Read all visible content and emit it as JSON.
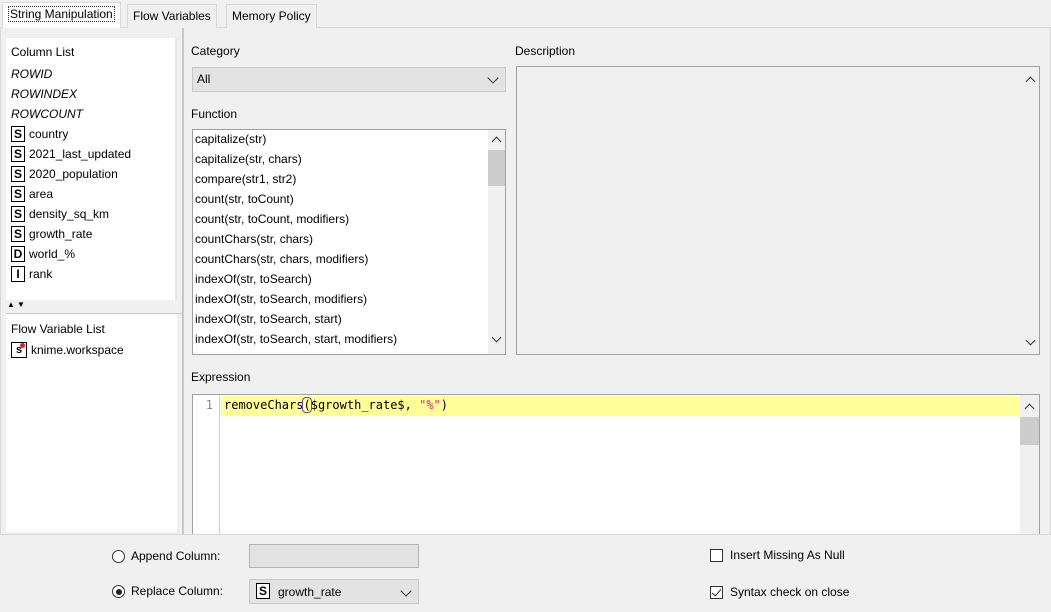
{
  "tabs": [
    {
      "label": "String Manipulation",
      "active": true
    },
    {
      "label": "Flow Variables",
      "active": false
    },
    {
      "label": "Memory Policy",
      "active": false
    }
  ],
  "column_list": {
    "title": "Column List",
    "special": [
      "ROWID",
      "ROWINDEX",
      "ROWCOUNT"
    ],
    "columns": [
      {
        "type": "S",
        "name": "country"
      },
      {
        "type": "S",
        "name": "2021_last_updated"
      },
      {
        "type": "S",
        "name": "2020_population"
      },
      {
        "type": "S",
        "name": "area"
      },
      {
        "type": "S",
        "name": "density_sq_km"
      },
      {
        "type": "S",
        "name": "growth_rate"
      },
      {
        "type": "D",
        "name": "world_%"
      },
      {
        "type": "I",
        "name": "rank"
      }
    ]
  },
  "flow_variable_list": {
    "title": "Flow Variable List",
    "items": [
      {
        "type": "s",
        "name": "knime.workspace"
      }
    ]
  },
  "category": {
    "label": "Category",
    "selected": "All"
  },
  "function": {
    "label": "Function",
    "items": [
      "capitalize(str)",
      "capitalize(str, chars)",
      "compare(str1, str2)",
      "count(str, toCount)",
      "count(str, toCount, modifiers)",
      "countChars(str, chars)",
      "countChars(str, chars, modifiers)",
      "indexOf(str, toSearch)",
      "indexOf(str, toSearch, modifiers)",
      "indexOf(str, toSearch, start)",
      "indexOf(str, toSearch, start, modifiers)"
    ]
  },
  "description": {
    "label": "Description"
  },
  "expression": {
    "label": "Expression",
    "line_number": "1",
    "code_fn": "removeChars",
    "code_paren": "(",
    "code_arg": "$growth_rate$, ",
    "code_str": "\"%\"",
    "code_close": ")"
  },
  "bottom": {
    "append_label": "Append Column:",
    "append_value": "",
    "replace_label": "Replace Column:",
    "replace_type": "S",
    "replace_value": "growth_rate",
    "insert_missing_label": "Insert Missing As Null",
    "insert_missing_checked": false,
    "syntax_check_label": "Syntax check on close",
    "syntax_check_checked": true,
    "selected_mode": "replace"
  }
}
